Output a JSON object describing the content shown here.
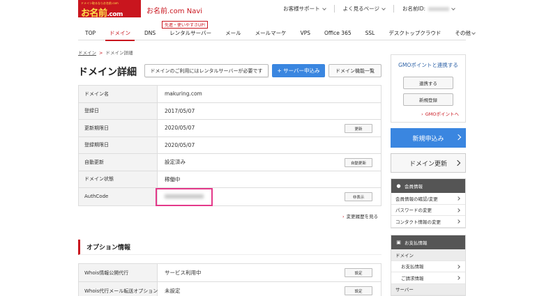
{
  "header": {
    "logo_tagline": "ドメイン取るならお名前.com",
    "logo_name": "お名前",
    "logo_suffix": ".com",
    "navi_title": "お名前.com Navi",
    "links": [
      "お客様サポート",
      "よく見るページ",
      "お名前ID:"
    ]
  },
  "menu": {
    "promo": "先進・使いやすさUP!",
    "items": [
      "TOP",
      "ドメイン",
      "DNS",
      "レンタルサーバー",
      "メール",
      "メールマーケ",
      "VPS",
      "Office 365",
      "SSL",
      "デスクトップクラウド",
      "その他"
    ]
  },
  "breadcrumb": {
    "root": "ドメイン",
    "sep": ">",
    "current": "ドメイン詳細"
  },
  "page": {
    "title": "ドメイン詳細",
    "notice": "ドメインのご利用にはレンタルサーバーが必要です",
    "server_button": "+ サーバー申込み",
    "functions_button": "ドメイン機能一覧"
  },
  "domain_table": {
    "rows": [
      {
        "label": "ドメイン名",
        "value": "makuring.com",
        "button": ""
      },
      {
        "label": "登録日",
        "value": "2017/05/07",
        "button": ""
      },
      {
        "label": "更新期限日",
        "value": "2020/05/07",
        "button": "更新"
      },
      {
        "label": "登録期限日",
        "value": "2020/05/07",
        "button": ""
      },
      {
        "label": "自動更新",
        "value": "設定済み",
        "button": "自動更新"
      },
      {
        "label": "ドメイン状態",
        "value": "稼働中",
        "button": ""
      },
      {
        "label": "AuthCode",
        "value": "",
        "button": "非表示"
      }
    ]
  },
  "history_link": "変更履歴を見る",
  "options": {
    "title": "オプション情報",
    "rows": [
      {
        "label": "Whois情報公開代行",
        "value": "サービス利用中",
        "button": "設定"
      },
      {
        "label": "Whois代行メール転送オプション",
        "value": "未設定",
        "button": "設定"
      }
    ]
  },
  "sidebar": {
    "gmo_title": "GMOポイントと連携する",
    "gmo_link_button": "連携する",
    "gmo_register_button": "新規登録",
    "gmo_points_link": "GMOポイントへ",
    "new_apply": "新規申込み",
    "domain_renew": "ドメイン更新",
    "member": {
      "title": "会員情報",
      "items": [
        "会員情報の確認/変更",
        "パスワードの変更",
        "コンタクト情報の変更"
      ]
    },
    "payment": {
      "title": "お支払情報",
      "section1": "ドメイン",
      "items": [
        "お支払情報",
        "ご請求情報"
      ],
      "section2": "サーバー"
    }
  }
}
